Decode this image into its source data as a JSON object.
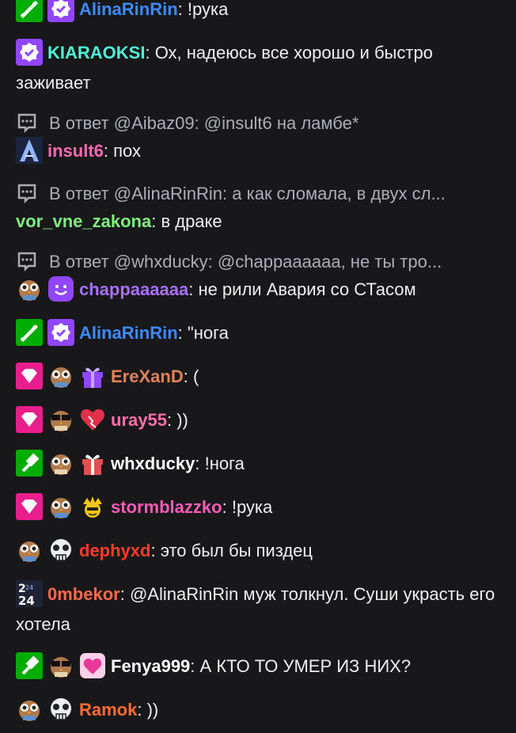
{
  "colors": {
    "background": "#18181b",
    "text": "#efeff1",
    "reply_text": "#adadb8",
    "mod_green": "#00ad03",
    "verified_purple": "#9147ff",
    "sub_pink": "#e91e8c"
  },
  "messages": [
    {
      "user": "AlinaRinRin",
      "color": "#3d8bff",
      "text": "!рука",
      "badges": [
        "moderator-sword-icon",
        "verified-check-icon"
      ]
    },
    {
      "user": "KIARAOKSI",
      "color": "#4ff3d6",
      "text": "Ох, надеюсь все хорошо и быстро заживает",
      "badges": [
        "verified-check-icon"
      ]
    },
    {
      "reply": "В ответ @Aibaz09: @insult6 на ламбе*",
      "user": "insult6",
      "color": "#ff69b4",
      "text": "пох",
      "badges": [
        "mountain-avatar-icon"
      ]
    },
    {
      "reply": "В ответ @AlinaRinRin: а как сломала, в двух сл...",
      "user": "vor_vne_zakona",
      "color": "#7ef07e",
      "text": "в драке",
      "badges": []
    },
    {
      "reply": "В ответ @whxducky: @chappaaaaaa, не ты тро...",
      "user": "chappaaaaaa",
      "color": "#a970ff",
      "text": "не рили Авария со СТасом",
      "badges": [
        "owl-sub-icon",
        "purple-smile-icon"
      ]
    },
    {
      "user": "AlinaRinRin",
      "color": "#3d8bff",
      "text": "\"нога",
      "badges": [
        "moderator-sword-icon",
        "verified-check-icon"
      ]
    },
    {
      "user": "EreXanD",
      "color": "#e0835b",
      "text": "(",
      "badges": [
        "vip-diamond-icon",
        "owl-sub-icon",
        "sub-gift-icon"
      ]
    },
    {
      "user": "uray55",
      "color": "#ff6fa8",
      "text": "))",
      "badges": [
        "vip-diamond-icon",
        "owl-glasses-icon",
        "heart-icon"
      ]
    },
    {
      "user": "whxducky",
      "color": "#ffffff",
      "text": "!нога",
      "badges": [
        "moderator-hammer-icon",
        "owl-sub-icon",
        "red-gift-icon"
      ]
    },
    {
      "user": "stormblazzko",
      "color": "#ff5ab8",
      "text": "!рука",
      "badges": [
        "vip-diamond-icon",
        "owl-sub-icon",
        "crown-face-icon"
      ]
    },
    {
      "user": "dephyxd",
      "color": "#ff3c28",
      "text": "это был бы пиздец",
      "badges": [
        "owl-sub-icon",
        "skull-face-icon"
      ]
    },
    {
      "user": "0mbekor",
      "color": "#ff6b4a",
      "text": "@AlinaRinRin муж толкнул. Суши украсть его хотела",
      "badges": [
        "calendar-24-icon"
      ]
    },
    {
      "user": "Fenya999",
      "color": "#ffffff",
      "text": "А КТО ТО УМЕР ИЗ НИХ?",
      "badges": [
        "moderator-hammer-icon",
        "owl-glasses-icon",
        "pink-heart-icon"
      ]
    },
    {
      "user": "Ramok",
      "color": "#ff6b32",
      "text": "))",
      "badges": [
        "owl-sub-icon",
        "skull-face-icon"
      ]
    }
  ]
}
